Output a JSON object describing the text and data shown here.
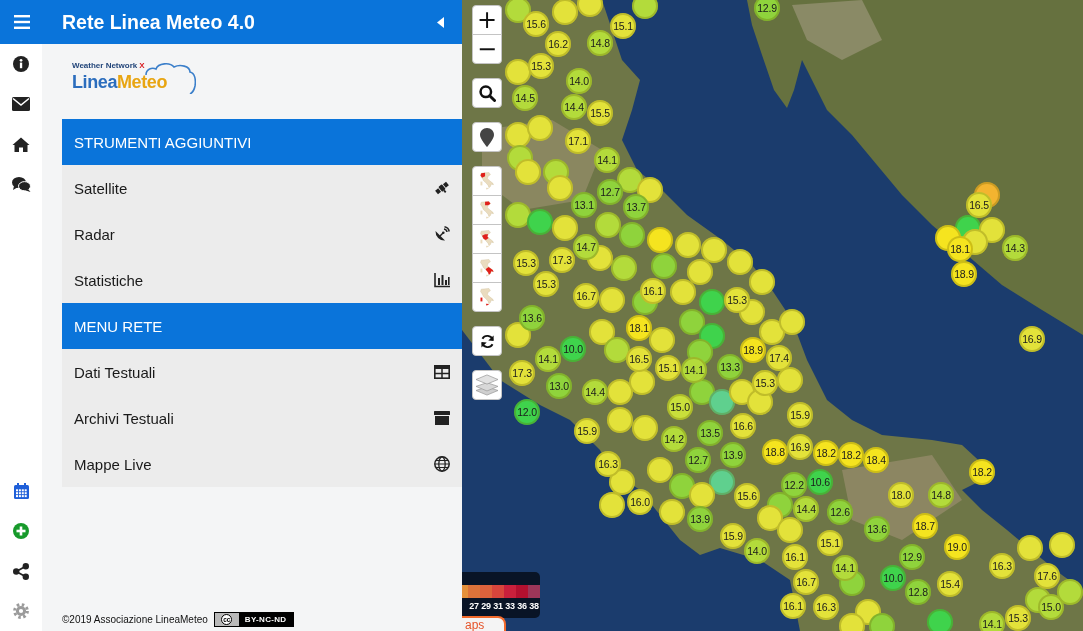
{
  "header": {
    "title": "Rete Linea Meteo 4.0"
  },
  "logo": {
    "tagline": "Weather Network",
    "mark": "X",
    "name_first": "Linea",
    "name_second": "Meteo"
  },
  "sections": [
    {
      "title": "STRUMENTI AGGIUNTIVI",
      "items": [
        {
          "label": "Satellite"
        },
        {
          "label": "Radar"
        },
        {
          "label": "Statistiche"
        }
      ]
    },
    {
      "title": "MENU RETE",
      "items": [
        {
          "label": "Dati Testuali"
        },
        {
          "label": "Archivi Testuali"
        },
        {
          "label": "Mappe Live"
        }
      ]
    }
  ],
  "footer": {
    "copyright": "©2019 Associazione LineaMeteo",
    "license_logo": "cc",
    "license": "BY-NC-ND"
  },
  "map_controls": {
    "zoom_in": "+",
    "zoom_out": "−"
  },
  "legend": {
    "stops": [
      {
        "color": "#e5913b"
      },
      {
        "label": "27",
        "color": "#dc733a"
      },
      {
        "label": "29",
        "color": "#dd623c"
      },
      {
        "label": "31",
        "color": "#d8453c"
      },
      {
        "label": "33",
        "color": "#c9203c"
      },
      {
        "label": "36",
        "color": "#b2102f"
      },
      {
        "label": "38",
        "color": "#9c3659"
      }
    ]
  },
  "map_buttons": [
    {
      "label": "aps"
    }
  ],
  "map": {
    "overlapped_markers": [
      {
        "color": "#b3db3b"
      },
      {
        "color": "#e3e23a"
      },
      {
        "color": "#e3e23a"
      },
      {
        "color": "#b3db3b"
      },
      {
        "color": "#e3e23a"
      },
      {
        "color": "#e3e23a"
      },
      {
        "color": "#e3e23a"
      },
      {
        "color": "#b3db3b"
      },
      {
        "color": "#e3e23a"
      },
      {
        "color": "#b3db3b"
      },
      {
        "color": "#e3e23a"
      },
      {
        "color": "#b3db3b"
      },
      {
        "color": "#e3e23a"
      },
      {
        "color": "#b3db3b"
      },
      {
        "color": "#3fd34c"
      },
      {
        "color": "#e3e23a"
      },
      {
        "color": "#b3db3b"
      },
      {
        "color": "#8fd33c"
      },
      {
        "color": "#f5e41f"
      },
      {
        "color": "#e3e23a"
      },
      {
        "color": "#e3e23a"
      },
      {
        "color": "#e3e23a"
      },
      {
        "color": "#e3e23a"
      },
      {
        "color": "#e3e23a"
      },
      {
        "color": "#8fd33c"
      },
      {
        "color": "#b3db3b"
      },
      {
        "color": "#e3e23a"
      },
      {
        "color": "#e3e23a"
      },
      {
        "color": "#e3e23a"
      },
      {
        "color": "#8fd33c"
      },
      {
        "color": "#e3e23a"
      },
      {
        "color": "#3fd34c"
      },
      {
        "color": "#8fd33c"
      },
      {
        "color": "#3fd34c"
      },
      {
        "color": "#e3e23a"
      },
      {
        "color": "#e3e23a"
      },
      {
        "color": "#e3e23a"
      },
      {
        "color": "#e3e23a"
      },
      {
        "color": "#b3db3b"
      },
      {
        "color": "#e3e23a"
      },
      {
        "color": "#8fd33c"
      },
      {
        "color": "#e3e23a"
      },
      {
        "color": "#e3e23a"
      },
      {
        "color": "#8fd33c"
      },
      {
        "color": "#5fd08e"
      },
      {
        "color": "#e3e23a"
      },
      {
        "color": "#e3e23a"
      },
      {
        "color": "#e3e23a"
      },
      {
        "color": "#e3e23a"
      },
      {
        "color": "#e3e23a"
      },
      {
        "color": "#5fd08e"
      },
      {
        "color": "#8fd33c"
      },
      {
        "color": "#e3e23a"
      },
      {
        "color": "#e3e23a"
      },
      {
        "color": "#e3e23a"
      },
      {
        "color": "#e3e23a"
      },
      {
        "color": "#e3e23a"
      },
      {
        "color": "#8fd33c"
      },
      {
        "color": "#e3e23a"
      },
      {
        "color": "#e3e23a"
      },
      {
        "color": "#8fd33c"
      },
      {
        "color": "#e3e23a"
      },
      {
        "color": "#8fd33c"
      },
      {
        "color": "#e3e23a"
      },
      {
        "color": "#3fd34c"
      },
      {
        "color": "#e3e23a"
      },
      {
        "color": "#e3e23a"
      },
      {
        "color": "#b3db3b"
      },
      {
        "color": "#b3db3b"
      },
      {
        "color": "#f3b430"
      },
      {
        "color": "#3fd34c"
      },
      {
        "color": "#e3e23a"
      },
      {
        "color": "#f5e41f"
      },
      {
        "color": "#e3e23a"
      }
    ],
    "markers": [
      {
        "value": "12.9",
        "color": "#8fd33c"
      },
      {
        "value": "15.6",
        "color": "#e3e23a"
      },
      {
        "value": "16.2",
        "color": "#e3e23a"
      },
      {
        "value": "15.3",
        "color": "#e3e23a"
      },
      {
        "value": "15.1",
        "color": "#e3e23a"
      },
      {
        "value": "14.8",
        "color": "#b3db3b"
      },
      {
        "value": "14.0",
        "color": "#b3db3b"
      },
      {
        "value": "14.5",
        "color": "#b3db3b"
      },
      {
        "value": "14.4",
        "color": "#b3db3b"
      },
      {
        "value": "15.5",
        "color": "#e3e23a"
      },
      {
        "value": "17.1",
        "color": "#e3e23a"
      },
      {
        "value": "14.1",
        "color": "#b3db3b"
      },
      {
        "value": "13.1",
        "color": "#8fd33c"
      },
      {
        "value": "12.7",
        "color": "#8fd33c"
      },
      {
        "value": "13.7",
        "color": "#8fd33c"
      },
      {
        "value": "14.7",
        "color": "#b3db3b"
      },
      {
        "value": "15.3",
        "color": "#e3e23a"
      },
      {
        "value": "17.3",
        "color": "#e3e23a"
      },
      {
        "value": "15.3",
        "color": "#e3e23a"
      },
      {
        "value": "16.7",
        "color": "#e3e23a"
      },
      {
        "value": "16.1",
        "color": "#e3e23a"
      },
      {
        "value": "15.3",
        "color": "#e3e23a"
      },
      {
        "value": "13.6",
        "color": "#8fd33c"
      },
      {
        "value": "10.0",
        "color": "#3fd34c"
      },
      {
        "value": "14.1",
        "color": "#b3db3b"
      },
      {
        "value": "17.3",
        "color": "#e3e23a"
      },
      {
        "value": "13.0",
        "color": "#8fd33c"
      },
      {
        "value": "14.4",
        "color": "#b3db3b"
      },
      {
        "value": "12.0",
        "color": "#3fd34c"
      },
      {
        "value": "15.9",
        "color": "#e3e23a"
      },
      {
        "value": "18.1",
        "color": "#f5e41f"
      },
      {
        "value": "16.5",
        "color": "#e3e23a"
      },
      {
        "value": "15.1",
        "color": "#e3e23a"
      },
      {
        "value": "14.1",
        "color": "#b3db3b"
      },
      {
        "value": "13.3",
        "color": "#8fd33c"
      },
      {
        "value": "18.9",
        "color": "#f5e41f"
      },
      {
        "value": "17.4",
        "color": "#e3e23a"
      },
      {
        "value": "15.3",
        "color": "#e3e23a"
      },
      {
        "value": "15.0",
        "color": "#c9df3b"
      },
      {
        "value": "16.6",
        "color": "#e3e23a"
      },
      {
        "value": "13.5",
        "color": "#8fd33c"
      },
      {
        "value": "14.2",
        "color": "#b3db3b"
      },
      {
        "value": "12.7",
        "color": "#8fd33c"
      },
      {
        "value": "13.9",
        "color": "#8fd33c"
      },
      {
        "value": "18.8",
        "color": "#f5e41f"
      },
      {
        "value": "16.3",
        "color": "#e3e23a"
      },
      {
        "value": "16.0",
        "color": "#e3e23a"
      },
      {
        "value": "15.6",
        "color": "#e3e23a"
      },
      {
        "value": "13.9",
        "color": "#8fd33c"
      },
      {
        "value": "15.9",
        "color": "#e3e23a"
      },
      {
        "value": "14.0",
        "color": "#b3db3b"
      },
      {
        "value": "16.9",
        "color": "#e3e23a"
      },
      {
        "value": "15.9",
        "color": "#e3e23a"
      },
      {
        "value": "16.9",
        "color": "#e3e23a"
      },
      {
        "value": "18.2",
        "color": "#f5e41f"
      },
      {
        "value": "18.2",
        "color": "#f5e41f"
      },
      {
        "value": "18.4",
        "color": "#f5e41f"
      },
      {
        "value": "18.2",
        "color": "#f5e41f"
      },
      {
        "value": "12.2",
        "color": "#8fd33c"
      },
      {
        "value": "10.6",
        "color": "#3fd34c"
      },
      {
        "value": "18.0",
        "color": "#e3e23a"
      },
      {
        "value": "14.8",
        "color": "#b3db3b"
      },
      {
        "value": "14.4",
        "color": "#b3db3b"
      },
      {
        "value": "12.6",
        "color": "#8fd33c"
      },
      {
        "value": "18.7",
        "color": "#f5e41f"
      },
      {
        "value": "13.6",
        "color": "#8fd33c"
      },
      {
        "value": "15.1",
        "color": "#e3e23a"
      },
      {
        "value": "19.0",
        "color": "#f5e41f"
      },
      {
        "value": "16.1",
        "color": "#e3e23a"
      },
      {
        "value": "14.1",
        "color": "#b3db3b"
      },
      {
        "value": "12.9",
        "color": "#8fd33c"
      },
      {
        "value": "16.3",
        "color": "#e3e23a"
      },
      {
        "value": "10.0",
        "color": "#3fd34c"
      },
      {
        "value": "16.7",
        "color": "#e3e23a"
      },
      {
        "value": "12.8",
        "color": "#8fd33c"
      },
      {
        "value": "15.4",
        "color": "#e3e23a"
      },
      {
        "value": "17.6",
        "color": "#e3e23a"
      },
      {
        "value": "16.1",
        "color": "#e3e23a"
      },
      {
        "value": "16.3",
        "color": "#e3e23a"
      },
      {
        "value": "15.0",
        "color": "#b3db3b"
      },
      {
        "value": "15.3",
        "color": "#e3e23a"
      },
      {
        "value": "14.1",
        "color": "#b3db3b"
      },
      {
        "value": "16.5",
        "color": "#e3e23a"
      },
      {
        "value": "18.1",
        "color": "#f5e41f"
      },
      {
        "value": "14.3",
        "color": "#b3db3b"
      },
      {
        "value": "18.9",
        "color": "#f5e41f"
      }
    ]
  }
}
